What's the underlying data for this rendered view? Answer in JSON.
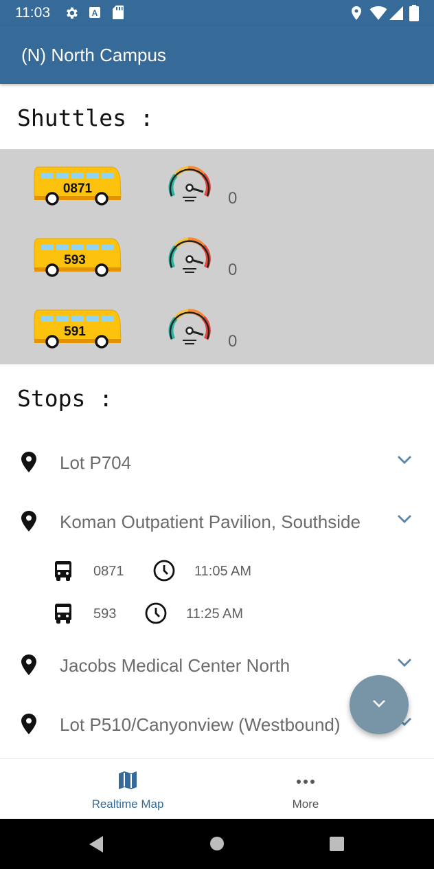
{
  "status_bar": {
    "time": "11:03",
    "icons": [
      "gear-icon",
      "a-badge-icon",
      "sd-card-icon",
      "location-icon",
      "wifi-icon",
      "signal-icon",
      "battery-icon"
    ]
  },
  "app_bar": {
    "title": "(N) North Campus"
  },
  "shuttles": {
    "heading": "Shuttles :",
    "items": [
      {
        "bus_number": "0871",
        "speed": "0"
      },
      {
        "bus_number": "593",
        "speed": "0"
      },
      {
        "bus_number": "591",
        "speed": "0"
      }
    ]
  },
  "stops": {
    "heading": "Stops :",
    "items": [
      {
        "name": "Lot P704",
        "expanded": false
      },
      {
        "name": "Koman Outpatient Pavilion, Southside",
        "expanded": true,
        "arrivals": [
          {
            "bus": "0871",
            "time": "11:05 AM"
          },
          {
            "bus": "593",
            "time": "11:25 AM"
          }
        ]
      },
      {
        "name": "Jacobs Medical Center North",
        "expanded": false
      },
      {
        "name": "Lot P510/Canyonview (Westbound)",
        "expanded": false
      }
    ]
  },
  "fab": {
    "icon": "chevron-down-icon"
  },
  "bottom_nav": {
    "items": [
      {
        "label": "Realtime Map",
        "icon": "map-icon",
        "active": true
      },
      {
        "label": "More",
        "icon": "more-dots-icon",
        "active": false
      }
    ]
  },
  "colors": {
    "primary": "#356a99",
    "shuttle_panel": "#cfcfcf",
    "bus_yellow": "#fdc20d",
    "fab": "#7895a8",
    "chevron": "#5a86ab"
  }
}
